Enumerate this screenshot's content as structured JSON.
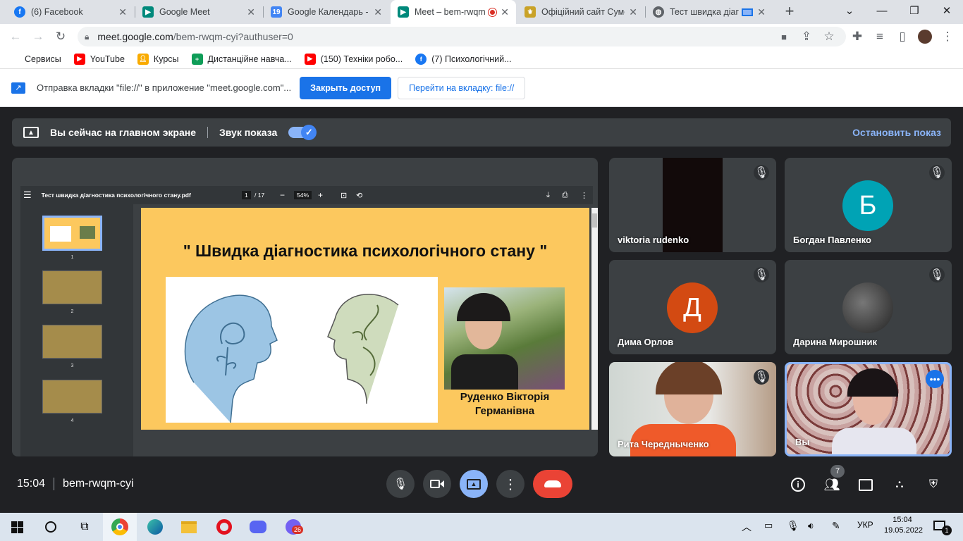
{
  "tabs": [
    {
      "title": "(6) Facebook",
      "icon": "facebook-icon",
      "color": "#1877f2"
    },
    {
      "title": "Google Meet",
      "icon": "google-meet-icon",
      "color": "#00897b"
    },
    {
      "title": "Google Календарь - с",
      "icon": "google-calendar-icon",
      "color": "#4285f4"
    },
    {
      "title": "Meet – bem-rwqm",
      "icon": "google-meet-icon",
      "color": "#00897b"
    },
    {
      "title": "Офіційний сайт Сумс",
      "icon": "crest-icon",
      "color": "#c9a227"
    },
    {
      "title": "Тест швидка діаг",
      "icon": "globe-icon",
      "color": "#5f6368"
    }
  ],
  "address": {
    "host": "meet.google.com",
    "path": "/bem-rwqm-cyi?authuser=0"
  },
  "bookmarks": [
    {
      "label": "Сервисы",
      "icon": "apps-grid-icon",
      "color": "#ea4335"
    },
    {
      "label": "YouTube",
      "icon": "youtube-icon",
      "color": "#ff0000"
    },
    {
      "label": "Курсы",
      "icon": "classroom-icon",
      "color": "#f9ab00"
    },
    {
      "label": "Дистанційне навча...",
      "icon": "sheets-icon",
      "color": "#0f9d58"
    },
    {
      "label": "(150) Техніки робо...",
      "icon": "youtube-icon",
      "color": "#ff0000"
    },
    {
      "label": "(7) Психологічний...",
      "icon": "facebook-icon",
      "color": "#1877f2"
    }
  ],
  "infobar": {
    "text": "Отправка вкладки \"file://\" в приложение \"meet.google.com\"...",
    "primary_btn": "Закрыть доступ",
    "secondary_btn": "Перейти на вкладку: file://"
  },
  "presenting": {
    "message": "Вы сейчас на главном экране",
    "sound_label": "Звук показа",
    "stop_label": "Остановить показ"
  },
  "pdf": {
    "filename": "Тест швидка діагностика психологічного стану.pdf",
    "page": "1",
    "total": "/ 17",
    "zoom": "54%",
    "thumb_numbers": [
      "1",
      "2",
      "3",
      "4"
    ]
  },
  "slide": {
    "title": "\" Швидка діагностика психологічного стану \"",
    "author_line1": "Руденко Вікторія",
    "author_line2": "Германівна"
  },
  "participants": [
    {
      "name": "viktoria rudenko",
      "muted": true
    },
    {
      "name": "Богдан Павленко",
      "initial": "Б",
      "color": "#00a3b5",
      "muted": true
    },
    {
      "name": "Дима Орлов",
      "initial": "Д",
      "color": "#d34a12",
      "muted": true
    },
    {
      "name": "Дарина Мирошник",
      "muted": true
    },
    {
      "name": "Рита Чередныченко",
      "muted": true
    },
    {
      "name": "Вы",
      "muted": false
    }
  ],
  "meeting": {
    "time": "15:04",
    "code": "bem-rwqm-cyi",
    "people_count": "7"
  },
  "taskbar": {
    "lang": "УКР",
    "time": "15:04",
    "date": "19.05.2022",
    "viber_badge": "26",
    "notif_badge": "1"
  }
}
